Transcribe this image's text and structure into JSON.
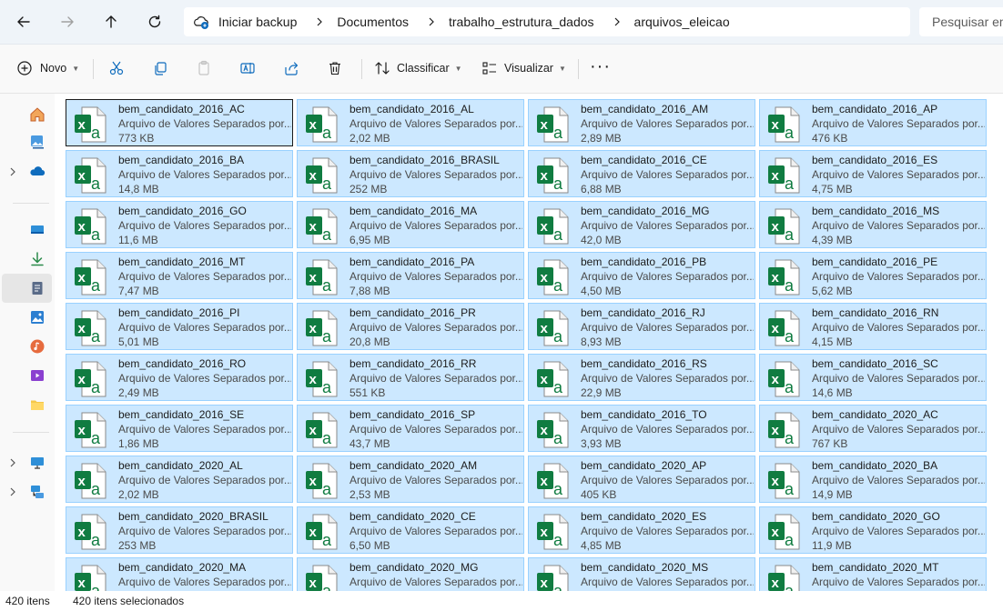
{
  "address": {
    "breadcrumbs": [
      "Iniciar backup",
      "Documentos",
      "trabalho_estrutura_dados",
      "arquivos_eleicao"
    ],
    "search_placeholder": "Pesquisar em"
  },
  "toolbar": {
    "new_label": "Novo",
    "sort_label": "Classificar",
    "view_label": "Visualizar"
  },
  "file_type": "Arquivo de Valores Separados por...",
  "files": [
    {
      "name": "bem_candidato_2016_AC",
      "size": "773 KB"
    },
    {
      "name": "bem_candidato_2016_AL",
      "size": "2,02 MB"
    },
    {
      "name": "bem_candidato_2016_AM",
      "size": "2,89 MB"
    },
    {
      "name": "bem_candidato_2016_AP",
      "size": "476 KB"
    },
    {
      "name": "bem_candidato_2016_BA",
      "size": "14,8 MB"
    },
    {
      "name": "bem_candidato_2016_BRASIL",
      "size": "252 MB"
    },
    {
      "name": "bem_candidato_2016_CE",
      "size": "6,88 MB"
    },
    {
      "name": "bem_candidato_2016_ES",
      "size": "4,75 MB"
    },
    {
      "name": "bem_candidato_2016_GO",
      "size": "11,6 MB"
    },
    {
      "name": "bem_candidato_2016_MA",
      "size": "6,95 MB"
    },
    {
      "name": "bem_candidato_2016_MG",
      "size": "42,0 MB"
    },
    {
      "name": "bem_candidato_2016_MS",
      "size": "4,39 MB"
    },
    {
      "name": "bem_candidato_2016_MT",
      "size": "7,47 MB"
    },
    {
      "name": "bem_candidato_2016_PA",
      "size": "7,88 MB"
    },
    {
      "name": "bem_candidato_2016_PB",
      "size": "4,50 MB"
    },
    {
      "name": "bem_candidato_2016_PE",
      "size": "5,62 MB"
    },
    {
      "name": "bem_candidato_2016_PI",
      "size": "5,01 MB"
    },
    {
      "name": "bem_candidato_2016_PR",
      "size": "20,8 MB"
    },
    {
      "name": "bem_candidato_2016_RJ",
      "size": "8,93 MB"
    },
    {
      "name": "bem_candidato_2016_RN",
      "size": "4,15 MB"
    },
    {
      "name": "bem_candidato_2016_RO",
      "size": "2,49 MB"
    },
    {
      "name": "bem_candidato_2016_RR",
      "size": "551 KB"
    },
    {
      "name": "bem_candidato_2016_RS",
      "size": "22,9 MB"
    },
    {
      "name": "bem_candidato_2016_SC",
      "size": "14,6 MB"
    },
    {
      "name": "bem_candidato_2016_SE",
      "size": "1,86 MB"
    },
    {
      "name": "bem_candidato_2016_SP",
      "size": "43,7 MB"
    },
    {
      "name": "bem_candidato_2016_TO",
      "size": "3,93 MB"
    },
    {
      "name": "bem_candidato_2020_AC",
      "size": "767 KB"
    },
    {
      "name": "bem_candidato_2020_AL",
      "size": "2,02 MB"
    },
    {
      "name": "bem_candidato_2020_AM",
      "size": "2,53 MB"
    },
    {
      "name": "bem_candidato_2020_AP",
      "size": "405 KB"
    },
    {
      "name": "bem_candidato_2020_BA",
      "size": "14,9 MB"
    },
    {
      "name": "bem_candidato_2020_BRASIL",
      "size": "253 MB"
    },
    {
      "name": "bem_candidato_2020_CE",
      "size": "6,50 MB"
    },
    {
      "name": "bem_candidato_2020_ES",
      "size": "4,85 MB"
    },
    {
      "name": "bem_candidato_2020_GO",
      "size": "11,9 MB"
    },
    {
      "name": "bem_candidato_2020_MA",
      "size": ""
    },
    {
      "name": "bem_candidato_2020_MG",
      "size": ""
    },
    {
      "name": "bem_candidato_2020_MS",
      "size": ""
    },
    {
      "name": "bem_candidato_2020_MT",
      "size": ""
    }
  ],
  "status": {
    "item_count": "420 itens",
    "selected_count": "420 itens selecionados"
  },
  "colors": {
    "selection_bg": "#cce8ff",
    "selection_border": "#99d1ff",
    "excel_green": "#107c41"
  }
}
